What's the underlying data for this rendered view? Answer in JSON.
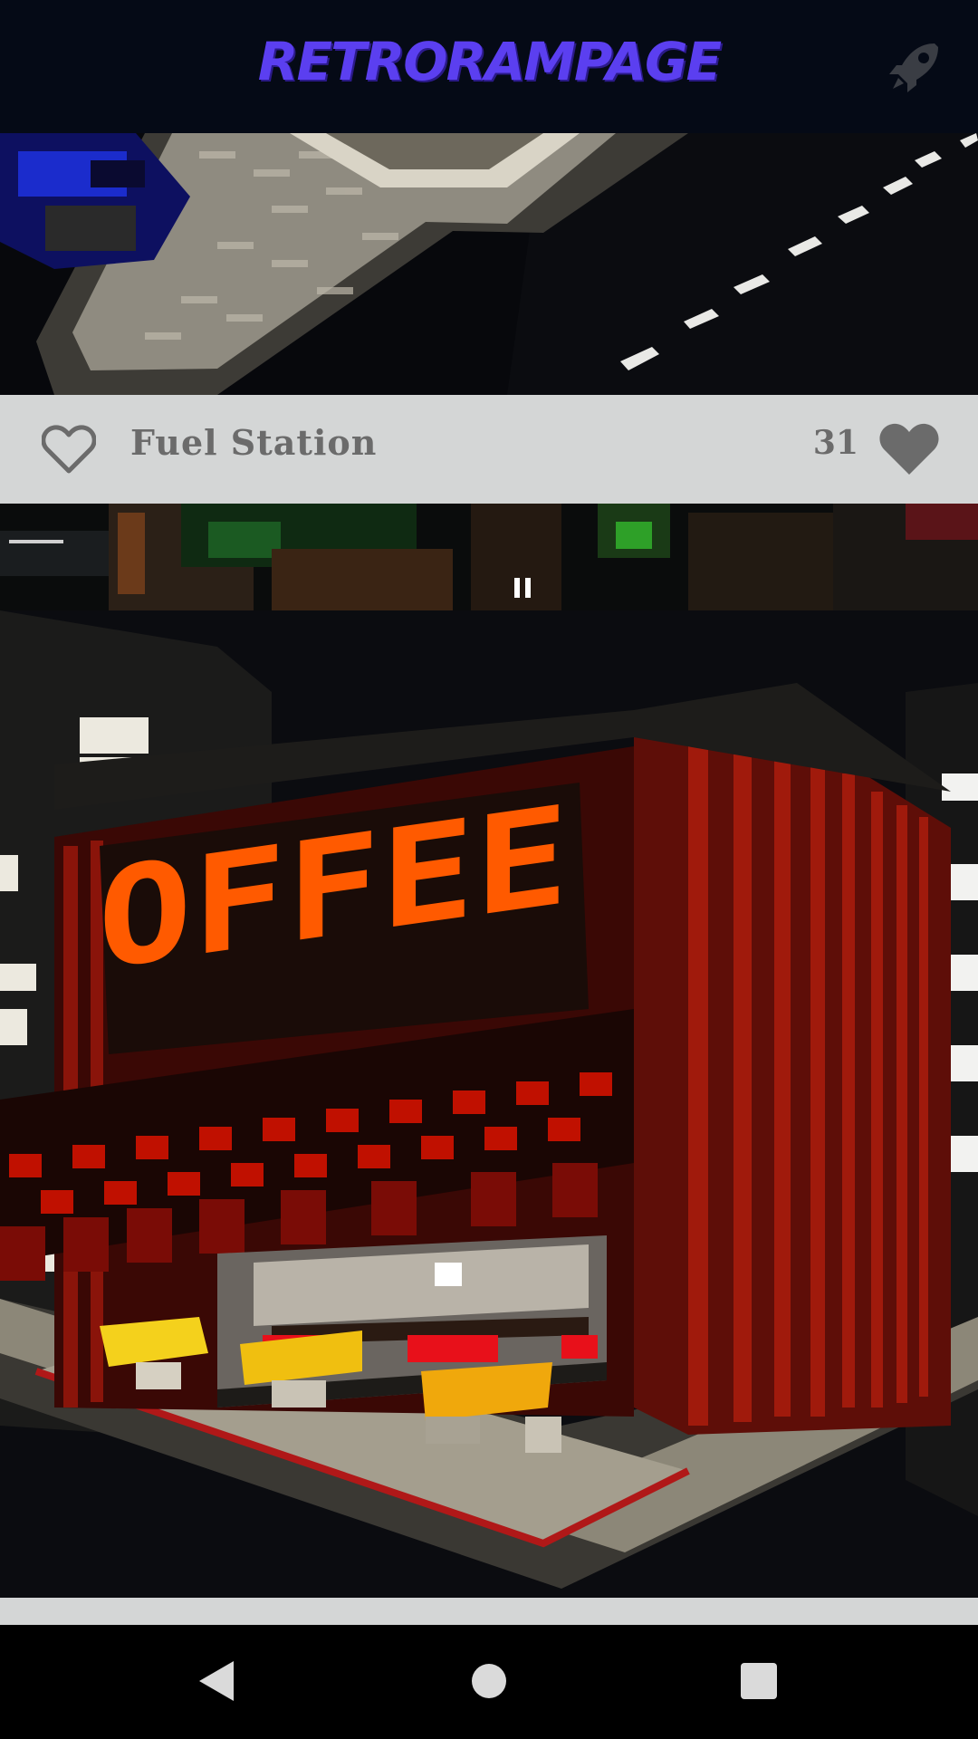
{
  "header": {
    "app_title": "RETRORAMPAGE",
    "title_color": "#5b3ff0",
    "action_icon": "rocket-icon"
  },
  "feed": {
    "posts": [
      {
        "title": "Fuel Station",
        "likes": "31",
        "liked": false
      },
      {
        "title": "",
        "sign_text": "OFFEE"
      }
    ]
  },
  "icons": {
    "like_outline": "heart-outline-icon",
    "like_count_icon": "heart-icon",
    "video": "pause-icon",
    "nav_back": "back-triangle-icon",
    "nav_home": "home-circle-icon",
    "nav_recents": "recents-square-icon"
  },
  "colors": {
    "bar_bg": "#d4d6d6",
    "bar_text": "#6b6b6b",
    "sign_orange": "#ff5a00",
    "awning_red": "#c01000"
  }
}
